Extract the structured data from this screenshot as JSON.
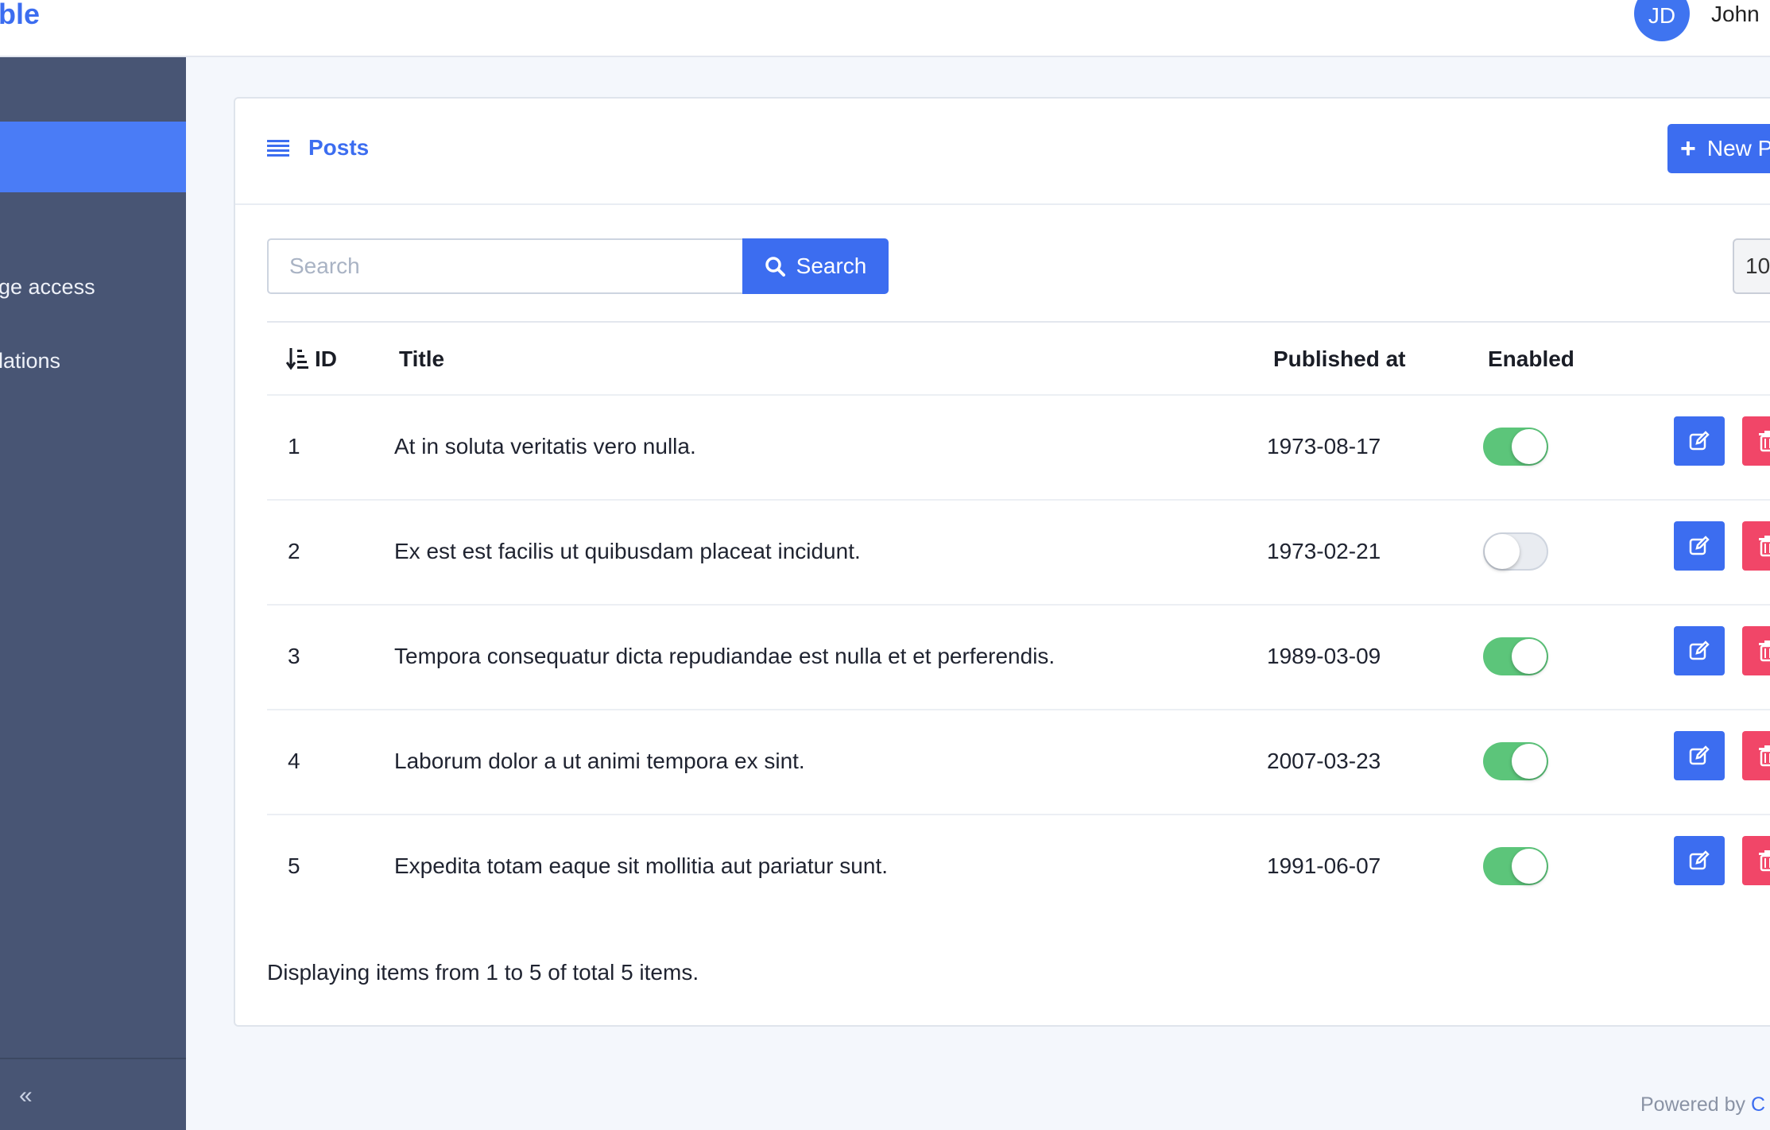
{
  "header": {
    "brand": "ble",
    "avatar_initials": "JD",
    "user_name": "John"
  },
  "sidebar": {
    "items": [
      {
        "label": "ge access"
      },
      {
        "label": "lations"
      }
    ],
    "collapse_glyph": "«"
  },
  "card": {
    "title": "Posts",
    "new_button_label": "New P",
    "search": {
      "placeholder": "Search",
      "button_label": "Search"
    },
    "per_page": "10"
  },
  "table": {
    "columns": [
      "ID",
      "Title",
      "Published at",
      "Enabled"
    ],
    "rows": [
      {
        "id": "1",
        "title": "At in soluta veritatis vero nulla.",
        "published_at": "1973-08-17",
        "enabled": true
      },
      {
        "id": "2",
        "title": "Ex est est facilis ut quibusdam placeat incidunt.",
        "published_at": "1973-02-21",
        "enabled": false
      },
      {
        "id": "3",
        "title": "Tempora consequatur dicta repudiandae est nulla et et perferendis.",
        "published_at": "1989-03-09",
        "enabled": true
      },
      {
        "id": "4",
        "title": "Laborum dolor a ut animi tempora ex sint.",
        "published_at": "2007-03-23",
        "enabled": true
      },
      {
        "id": "5",
        "title": "Expedita totam eaque sit mollitia aut pariatur sunt.",
        "published_at": "1991-06-07",
        "enabled": true
      }
    ]
  },
  "pagination_info": "Displaying items from 1 to 5 of total 5 items.",
  "footer": {
    "powered_by": "Powered by",
    "link_fragment": "C"
  },
  "colors": {
    "accent": "#3c6df0",
    "sidebar": "#485574",
    "danger": "#f14668",
    "toggle_on": "#5cc57a"
  },
  "icons": [
    "list-icon",
    "plus-icon",
    "search-icon",
    "sort-descending-icon",
    "edit-icon",
    "trash-icon",
    "double-chevron-left-icon"
  ]
}
